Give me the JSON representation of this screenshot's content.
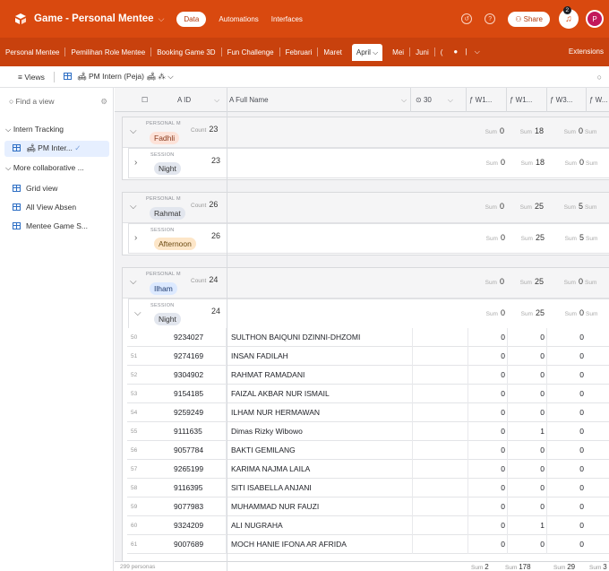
{
  "app": {
    "title": "Game - Personal Mentee"
  },
  "topnav": {
    "data": "Data",
    "automations": "Automations",
    "interfaces": "Interfaces",
    "share": "Share",
    "notif_count": "2",
    "avatar_initial": "P"
  },
  "tabs": [
    {
      "label": "Personal Mentee"
    },
    {
      "label": "Pemilihan Role Mentee"
    },
    {
      "label": "Booking Game 3D"
    },
    {
      "label": "Fun Challenge"
    },
    {
      "label": "Februari"
    },
    {
      "label": "Maret"
    },
    {
      "label": "April ⌵",
      "active": true
    },
    {
      "label": "Mei"
    },
    {
      "label": "Juni"
    },
    {
      "label": "("
    }
  ],
  "extensions": "Extensions",
  "viewbar": {
    "views": "Views",
    "current_view": "PM Intern (Peja)"
  },
  "sidebar": {
    "find_placeholder": "Find a view",
    "section1": "Intern Tracking",
    "view_pm": "PM Inter...",
    "section2": "More collaborative ...",
    "views": [
      "Grid view",
      "All View Absen",
      "Mentee Game S..."
    ]
  },
  "columns": {
    "id": "ID",
    "full_name": "Full Name",
    "col30": "30",
    "w1": "W1...",
    "w1b": "W1...",
    "w3": "W3...",
    "w4": "W..."
  },
  "groups": [
    {
      "label": "PERSONAL M",
      "name": "Fadhli",
      "count": "23",
      "chip_bg": "#fde2d8",
      "chip_fg": "#8a3a1c",
      "sums": [
        "0",
        "18",
        "0",
        ""
      ],
      "session": {
        "label": "SESSION",
        "name": "Night",
        "count": "23",
        "chip_bg": "#e2e6ee",
        "sums": [
          "0",
          "18",
          "0",
          ""
        ]
      }
    },
    {
      "label": "PERSONAL M",
      "name": "Rahmat",
      "count": "26",
      "chip_bg": "#e2e6ee",
      "chip_fg": "#333333",
      "sums": [
        "0",
        "25",
        "5",
        ""
      ],
      "session": {
        "label": "SESSION",
        "name": "Afternoon",
        "count": "26",
        "chip_bg": "#fde6c8",
        "sums": [
          "0",
          "25",
          "5",
          ""
        ]
      }
    },
    {
      "label": "PERSONAL M",
      "name": "Ilham",
      "count": "24",
      "chip_bg": "#dce9ff",
      "chip_fg": "#1e3a6e",
      "sums": [
        "0",
        "25",
        "0",
        ""
      ],
      "session": {
        "label": "SESSION",
        "name": "Night",
        "count": "24",
        "chip_bg": "#e2e6ee",
        "sums": [
          "0",
          "25",
          "0",
          ""
        ]
      }
    }
  ],
  "sum_label": "Sum",
  "count_label": "Count",
  "rows": [
    {
      "num": "50",
      "id": "9234027",
      "name": "SULTHON BAIQUNI DZINNI-DHZOMI",
      "w1": "0",
      "w1b": "0",
      "w3": "0"
    },
    {
      "num": "51",
      "id": "9274169",
      "name": "INSAN FADILAH",
      "w1": "0",
      "w1b": "0",
      "w3": "0"
    },
    {
      "num": "52",
      "id": "9304902",
      "name": "RAHMAT RAMADANI",
      "w1": "0",
      "w1b": "0",
      "w3": "0"
    },
    {
      "num": "53",
      "id": "9154185",
      "name": "FAIZAL AKBAR NUR ISMAIL",
      "w1": "0",
      "w1b": "0",
      "w3": "0"
    },
    {
      "num": "54",
      "id": "9259249",
      "name": "ILHAM NUR HERMAWAN",
      "w1": "0",
      "w1b": "0",
      "w3": "0"
    },
    {
      "num": "55",
      "id": "9111635",
      "name": "Dimas Rizky Wibowo",
      "w1": "0",
      "w1b": "1",
      "w3": "0"
    },
    {
      "num": "56",
      "id": "9057784",
      "name": "BAKTI GEMILANG",
      "w1": "0",
      "w1b": "0",
      "w3": "0"
    },
    {
      "num": "57",
      "id": "9265199",
      "name": "KARIMA NAJMA LAILA",
      "w1": "0",
      "w1b": "0",
      "w3": "0"
    },
    {
      "num": "58",
      "id": "9116395",
      "name": "SITI ISABELLA ANJANI",
      "w1": "0",
      "w1b": "0",
      "w3": "0"
    },
    {
      "num": "59",
      "id": "9077983",
      "name": "MUHAMMAD NUR FAUZI",
      "w1": "0",
      "w1b": "0",
      "w3": "0"
    },
    {
      "num": "60",
      "id": "9324209",
      "name": "ALI NUGRAHA",
      "w1": "0",
      "w1b": "1",
      "w3": "0"
    },
    {
      "num": "61",
      "id": "9007689",
      "name": "MOCH HANIE IFONA AR AFRIDA",
      "w1": "0",
      "w1b": "0",
      "w3": "0"
    }
  ],
  "footer": {
    "records": "299 personas",
    "sums": [
      "2",
      "178",
      "29",
      "3"
    ]
  }
}
